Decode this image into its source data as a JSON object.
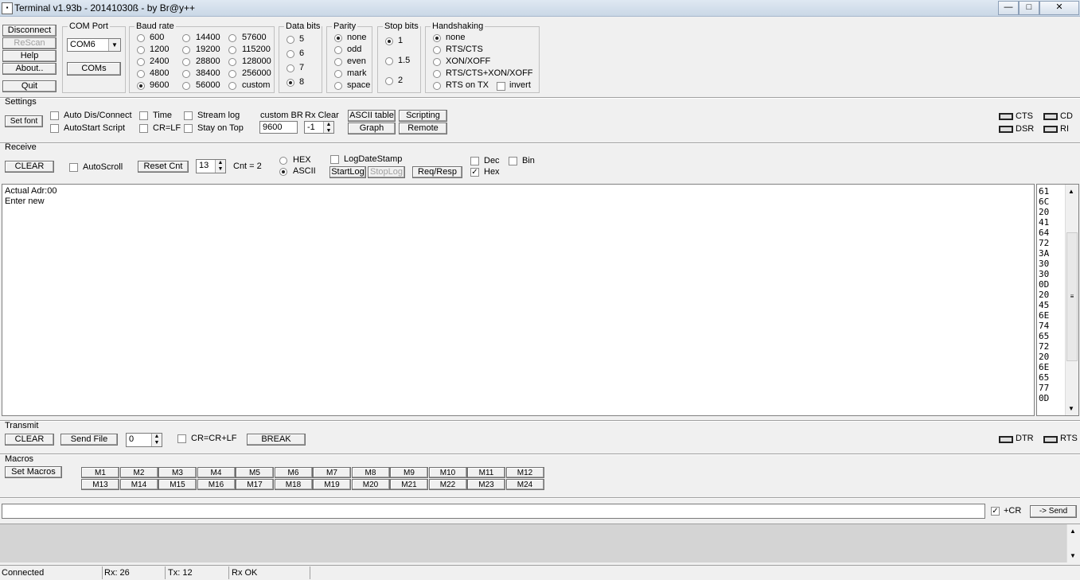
{
  "window": {
    "title": "Terminal v1.93b - 20141030ß - by Br@y++",
    "minimize": "—",
    "maximize": "□",
    "close": "✕"
  },
  "left_buttons": {
    "disconnect": "Disconnect",
    "rescan": "ReScan",
    "help": "Help",
    "about": "About..",
    "quit": "Quit"
  },
  "com_port": {
    "label": "COM Port",
    "value": "COM6",
    "coms_button": "COMs"
  },
  "baud": {
    "label": "Baud rate",
    "options": [
      "600",
      "1200",
      "2400",
      "4800",
      "9600",
      "14400",
      "19200",
      "28800",
      "38400",
      "56000",
      "57600",
      "115200",
      "128000",
      "256000",
      "custom"
    ],
    "selected": "9600"
  },
  "databits": {
    "label": "Data bits",
    "options": [
      "5",
      "6",
      "7",
      "8"
    ],
    "selected": "8"
  },
  "parity": {
    "label": "Parity",
    "options": [
      "none",
      "odd",
      "even",
      "mark",
      "space"
    ],
    "selected": "none"
  },
  "stopbits": {
    "label": "Stop bits",
    "options": [
      "1",
      "1.5",
      "2"
    ],
    "selected": "1"
  },
  "handshaking": {
    "label": "Handshaking",
    "options": [
      "none",
      "RTS/CTS",
      "XON/XOFF",
      "RTS/CTS+XON/XOFF",
      "RTS on TX"
    ],
    "selected": "none",
    "invert": "invert"
  },
  "settings": {
    "label": "Settings",
    "set_font": "Set font",
    "auto_dis_connect": "Auto Dis/Connect",
    "autostart_script": "AutoStart Script",
    "time": "Time",
    "crlf": "CR=LF",
    "stream_log": "Stream log",
    "stay_on_top": "Stay on Top",
    "custom_br_label": "custom BR",
    "custom_br_value": "9600",
    "rx_clear_label": "Rx Clear",
    "rx_clear_value": "-1",
    "ascii_table": "ASCII table",
    "scripting": "Scripting",
    "graph": "Graph",
    "remote": "Remote"
  },
  "indicators": {
    "cts": "CTS",
    "cd": "CD",
    "dsr": "DSR",
    "ri": "RI",
    "dtr": "DTR",
    "rts": "RTS"
  },
  "receive": {
    "label": "Receive",
    "clear": "CLEAR",
    "autoscroll": "AutoScroll",
    "reset_cnt": "Reset Cnt",
    "cnt_value": "13",
    "cnt_text": "Cnt =  2",
    "hex": "HEX",
    "ascii": "ASCII",
    "log_date_stamp": "LogDateStamp",
    "start_log": "StartLog",
    "stop_log": "StopLog",
    "req_resp": "Req/Resp",
    "dec": "Dec",
    "bin": "Bin",
    "hex_chk": "Hex",
    "lines": [
      "Actual Adr:00",
      "Enter new"
    ],
    "hex_values": [
      "61",
      "6C",
      "20",
      "41",
      "64",
      "72",
      "3A",
      "30",
      "30",
      "0D",
      "20",
      "45",
      "6E",
      "74",
      "65",
      "72",
      "20",
      "6E",
      "65",
      "77",
      "0D"
    ]
  },
  "transmit": {
    "label": "Transmit",
    "clear": "CLEAR",
    "send_file": "Send File",
    "count": "0",
    "cr_crlf": "CR=CR+LF",
    "break": "BREAK"
  },
  "macros": {
    "label": "Macros",
    "set_macros": "Set Macros",
    "row1": [
      "M1",
      "M2",
      "M3",
      "M4",
      "M5",
      "M6",
      "M7",
      "M8",
      "M9",
      "M10",
      "M11",
      "M12"
    ],
    "row2": [
      "M13",
      "M14",
      "M15",
      "M16",
      "M17",
      "M18",
      "M19",
      "M20",
      "M21",
      "M22",
      "M23",
      "M24"
    ]
  },
  "send": {
    "input": "",
    "plus_cr": "+CR",
    "send_button": "-> Send"
  },
  "status": {
    "connected": "Connected",
    "rx": "Rx: 26",
    "tx": "Tx: 12",
    "rxok": "Rx OK"
  }
}
